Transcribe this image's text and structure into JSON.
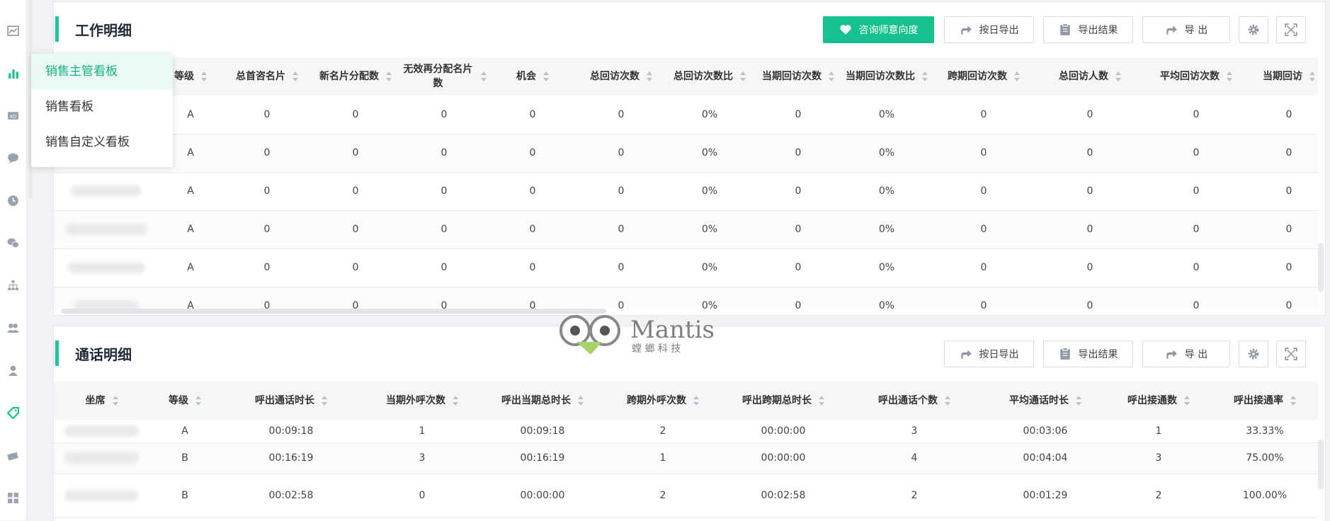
{
  "dropdown": {
    "items": [
      {
        "label": "销售主管看板",
        "active": true
      },
      {
        "label": "销售看板",
        "active": false
      },
      {
        "label": "销售自定义看板",
        "active": false
      }
    ]
  },
  "work": {
    "title": "工作明细",
    "buttons": {
      "consult": "咨询师意向度",
      "daily_export": "按日导出",
      "export_result": "导出结果",
      "export": "导 出"
    },
    "columns": [
      "",
      "等级",
      "总首咨名片",
      "新名片分配数",
      "无效再分配名片数",
      "机会",
      "总回访次数",
      "总回访次数比",
      "当期回访次数",
      "当期回访次数比",
      "跨期回访次数",
      "总回访人数",
      "平均回访次数",
      "当期回访"
    ],
    "rows": [
      [
        "",
        "A",
        "0",
        "0",
        "0",
        "0",
        "0",
        "0%",
        "0",
        "0%",
        "0",
        "0",
        "0",
        "0"
      ],
      [
        "",
        "A",
        "0",
        "0",
        "0",
        "0",
        "0",
        "0%",
        "0",
        "0%",
        "0",
        "0",
        "0",
        "0"
      ],
      [
        "",
        "A",
        "0",
        "0",
        "0",
        "0",
        "0",
        "0%",
        "0",
        "0%",
        "0",
        "0",
        "0",
        "0"
      ],
      [
        "",
        "A",
        "0",
        "0",
        "0",
        "0",
        "0",
        "0%",
        "0",
        "0%",
        "0",
        "0",
        "0",
        "0"
      ],
      [
        "",
        "A",
        "0",
        "0",
        "0",
        "0",
        "0",
        "0%",
        "0",
        "0%",
        "0",
        "0",
        "0",
        "0"
      ],
      [
        "",
        "A",
        "0",
        "0",
        "0",
        "0",
        "0",
        "0%",
        "0",
        "0%",
        "0",
        "0",
        "0",
        "0"
      ]
    ]
  },
  "call": {
    "title": "通话明细",
    "buttons": {
      "daily_export": "按日导出",
      "export_result": "导出结果",
      "export": "导 出"
    },
    "columns": [
      "坐席",
      "等级",
      "呼出通话时长",
      "当期外呼次数",
      "呼出当期总时长",
      "跨期外呼次数",
      "呼出跨期总时长",
      "呼出通话个数",
      "平均通话时长",
      "呼出接通数",
      "呼出接通率"
    ],
    "rows": [
      [
        "",
        "A",
        "00:09:18",
        "1",
        "00:09:18",
        "2",
        "00:00:00",
        "3",
        "00:03:06",
        "1",
        "33.33%"
      ],
      [
        "",
        "B",
        "00:16:19",
        "3",
        "00:16:19",
        "1",
        "00:00:00",
        "4",
        "00:04:04",
        "3",
        "75.00%"
      ],
      [
        "",
        "B",
        "00:02:58",
        "0",
        "00:00:00",
        "2",
        "00:02:58",
        "2",
        "00:01:29",
        "2",
        "100.00%"
      ]
    ]
  },
  "watermark": {
    "brand": "Mantis",
    "sub": "螳 螂 科 技"
  },
  "colors": {
    "accent": "#17c08f",
    "title_bar": "#1fc59a",
    "dropdown_active_bg": "#e8faf3"
  }
}
